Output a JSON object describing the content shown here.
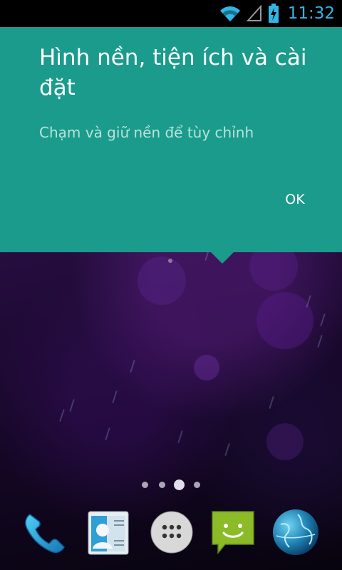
{
  "status_bar": {
    "time": "11:32",
    "icons": [
      "wifi-icon",
      "signal-icon",
      "battery-charging-icon"
    ],
    "accent_color": "#33b5e5"
  },
  "cling": {
    "title": "Hình nền, tiện ích và cài đặt",
    "body": "Chạm và giữ nền để tùy chỉnh",
    "ok_label": "OK",
    "background_color": "#1a9b8c"
  },
  "home": {
    "page_count": 4,
    "current_page": 3
  },
  "hotseat": {
    "apps": [
      "phone-icon",
      "contacts-icon",
      "all-apps-icon",
      "messaging-icon",
      "browser-icon"
    ]
  }
}
